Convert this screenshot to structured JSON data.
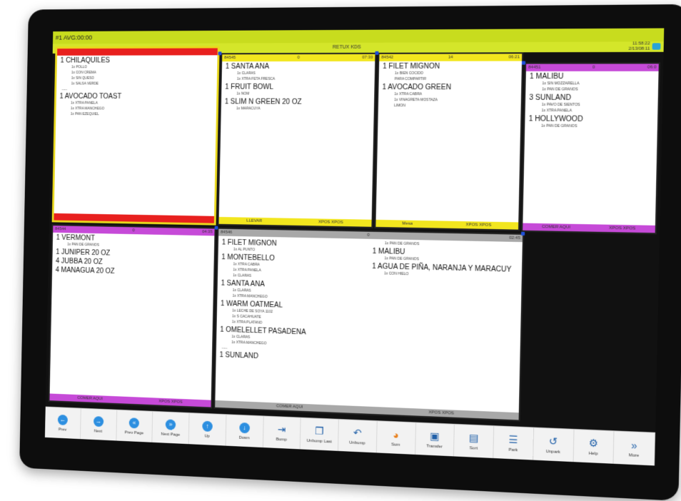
{
  "topbar": {
    "left": "#1   AVG:00:00"
  },
  "titlebar": {
    "title": "RETUX KDS"
  },
  "clock": {
    "line1": "11:58:22",
    "line2": "2/13/08:11"
  },
  "tickets": [
    {
      "id": "t1",
      "header_left": "",
      "header_mid": "",
      "header_right": "",
      "items": [
        {
          "text": "1  CHILAQUILES",
          "mods": [
            "1x POLLO",
            "1x CON CREMA",
            "1x SIN QUESO",
            "1x SALSA VERDE"
          ]
        },
        {
          "sep": "------"
        },
        {
          "text": "1  AVOCADO TOAST",
          "mods": [
            "1x XTRA PANELA",
            "1x XTRA MANCHEGO",
            "1x PAN EZEQUIEL"
          ]
        }
      ],
      "footer_left": "",
      "footer_right": ""
    },
    {
      "id": "t2",
      "header_left": "84545",
      "header_mid": "0",
      "header_right": "07:30",
      "items": [
        {
          "text": "1  SANTA ANA",
          "mods": [
            "1x CLARAS",
            "1x XTRA FETA FRESCA"
          ]
        },
        {
          "text": "1  FRUIT BOWL",
          "mods": [
            "1x NOM"
          ]
        },
        {
          "text": "1  SLIM N GREEN 20 OZ",
          "mods": [
            "1x MARACUYA"
          ]
        }
      ],
      "footer_left": "LLEVAR",
      "footer_right": "XPOS XPOS"
    },
    {
      "id": "t3",
      "header_left": "84542",
      "header_mid": "14",
      "header_right": "06:21",
      "items": [
        {
          "text": "1  FILET MIGNON",
          "mods": [
            "1x BIEN COCIDO",
            "PARA COMPARTIR"
          ]
        },
        {
          "text": "1  AVOCADO GREEN",
          "mods": [
            "1x XTRA CABRA",
            "1x VINAGRETA MOSTAZA",
            "LIMON"
          ]
        }
      ],
      "footer_left": "Mesa",
      "footer_right": "XPOS XPOS"
    },
    {
      "id": "t4",
      "header_left": "84451",
      "header_mid": "0",
      "header_right": "06:0",
      "items": [
        {
          "text": "1  MALIBU",
          "mods": [
            "1x SIN MOZZARELLA",
            "1x PAN DE GRANOS"
          ]
        },
        {
          "text": "3  SUNLAND",
          "mods": [
            "1x PAVO DE SIENTOS",
            "1x XTRA PANELA"
          ]
        },
        {
          "text": "1  HOLLYWOOD",
          "mods": [
            "1x PAN DE GRANOS"
          ]
        }
      ],
      "footer_left": "COMER AQUI",
      "footer_right": "XPOS XPOS"
    },
    {
      "id": "t5",
      "header_left": "84544",
      "header_mid": "0",
      "header_right": "04:35",
      "items": [
        {
          "text": "1  VERMONT",
          "mods": [
            "1x PAN DE GRANOS"
          ]
        },
        {
          "text": "1  JUNIPER 20 OZ",
          "mods": []
        },
        {
          "text": "4  JUBBA 20 OZ",
          "mods": []
        },
        {
          "text": "4  MANAGUA 20 OZ",
          "mods": []
        }
      ],
      "footer_left": "COMER AQUI",
      "footer_right": "XPOS XPOS"
    },
    {
      "id": "t6",
      "header_left": "84546",
      "header_mid": "0",
      "header_right": "02:45",
      "items_left": [
        {
          "text": "1  FILET MIGNON",
          "mods": [
            "1x AL PUNTO"
          ]
        },
        {
          "text": "1  MONTEBELLO",
          "mods": [
            "1x XTRA CABRA",
            "1x XTRA PANELA",
            "1x CLARAS"
          ]
        },
        {
          "text": "1  SANTA ANA",
          "mods": [
            "1x CLARAS",
            "1x XTRA MANCHEGO"
          ]
        },
        {
          "text": "1  WARM OATMEAL",
          "mods": [
            "1x LECHE DE SOYA 1102",
            "1x S CACAHUATE",
            "1x XTRA PLATANO"
          ]
        },
        {
          "text": "1  OMELELLET PASADENA",
          "mods": [
            "1x CLARAS",
            "1x XTRA MANCHEGO"
          ]
        },
        {
          "sep": "------"
        },
        {
          "text": "1  SUNLAND",
          "mods": []
        }
      ],
      "items_right": [
        {
          "text": "",
          "mods": [
            "1x PAN DE GRANOS"
          ]
        },
        {
          "text": "1  MALIBU",
          "mods": [
            "1x PAN DE GRANOS"
          ]
        },
        {
          "text": "1  AGUA DE PIÑA, NARANJA Y MARACUY",
          "mods": [
            "1x CON HIELO"
          ]
        }
      ],
      "footer_left": "COMER AQUI",
      "footer_right": "XPOS XPOS"
    }
  ],
  "toolbar": [
    {
      "name": "prev-button",
      "label": "Prev",
      "icon": "arrow-left-icon",
      "glyph": "←"
    },
    {
      "name": "next-button",
      "label": "Next",
      "icon": "arrow-right-icon",
      "glyph": "→"
    },
    {
      "name": "prev-page-button",
      "label": "Prev Page",
      "icon": "double-left-icon",
      "glyph": "«"
    },
    {
      "name": "next-page-button",
      "label": "Next Page",
      "icon": "double-right-icon",
      "glyph": "»"
    },
    {
      "name": "up-button",
      "label": "Up",
      "icon": "arrow-up-icon",
      "glyph": "↑"
    },
    {
      "name": "down-button",
      "label": "Down",
      "icon": "arrow-down-icon",
      "glyph": "↓"
    },
    {
      "name": "bump-button",
      "label": "Bump",
      "icon": "bump-icon",
      "glyph": "⇥"
    },
    {
      "name": "unbump-last-button",
      "label": "Unbump Last",
      "icon": "windows-icon",
      "glyph": "❐"
    },
    {
      "name": "unbump-button",
      "label": "Unbump",
      "icon": "undo-icon",
      "glyph": "↶"
    },
    {
      "name": "sum-button",
      "label": "Sum",
      "icon": "pie-chart-icon",
      "glyph": "◕"
    },
    {
      "name": "transfer-button",
      "label": "Transfer",
      "icon": "transfer-icon",
      "glyph": "▣"
    },
    {
      "name": "sort-button",
      "label": "Sort",
      "icon": "sort-icon",
      "glyph": "▤"
    },
    {
      "name": "park-button",
      "label": "Park",
      "icon": "list-icon",
      "glyph": "☰"
    },
    {
      "name": "unpark-button",
      "label": "Unpark",
      "icon": "undo-arrow-icon",
      "glyph": "↺"
    },
    {
      "name": "help-button",
      "label": "Help",
      "icon": "help-icon",
      "glyph": "⚙"
    },
    {
      "name": "more-button",
      "label": "More",
      "icon": "chevrons-right-icon",
      "glyph": "»"
    }
  ],
  "colors": {
    "topbar": "#c8dc1e",
    "red": "#e8201e",
    "yellow": "#f2e61e",
    "purple": "#c64ad8",
    "gray": "#a8a8a8",
    "toolbar_accent": "#2d8fe0"
  }
}
